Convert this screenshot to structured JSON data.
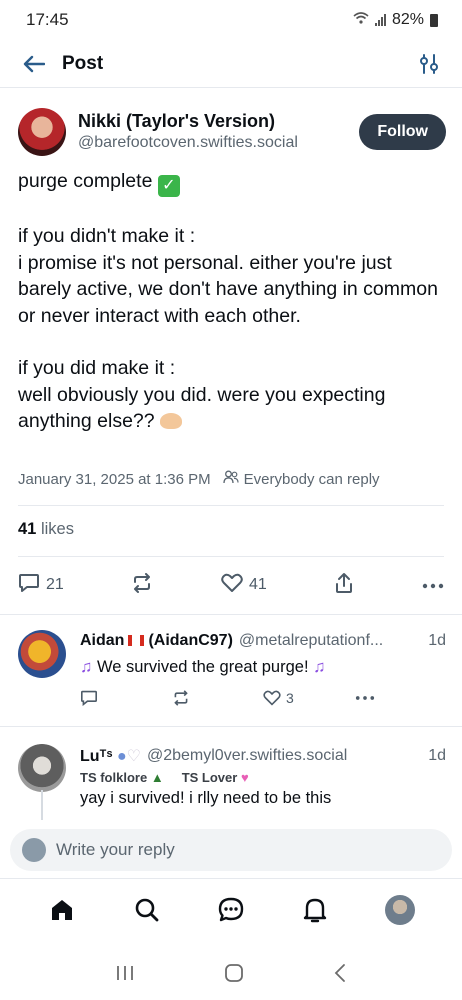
{
  "status_bar": {
    "time": "17:45",
    "battery": "82%"
  },
  "header": {
    "title": "Post"
  },
  "post": {
    "author_name": "Nikki (Taylor's Version)",
    "author_handle": "@barefootcoven.swifties.social",
    "follow_label": "Follow",
    "paragraph1": "purge complete",
    "paragraph2": "if you didn't make it :\ni promise it's not personal. either you're just barely active, we don't have anything in common or never interact with each other.",
    "paragraph3": "if you did make it :\nwell obviously you did. were you expecting anything else??",
    "timestamp": "January 31, 2025 at 1:36 PM",
    "reply_setting": "Everybody can reply",
    "likes_count": "41",
    "likes_label": "likes",
    "reply_count": "21",
    "like_count_action": "41"
  },
  "replies": [
    {
      "name": "Aidan",
      "name_suffix": "(AidanC97)",
      "handle": "@metalreputationf...",
      "time": "1d",
      "text": "We survived the great purge!",
      "like_count": "3"
    },
    {
      "name": "Luᵀˢ",
      "handle": "@2bemyl0ver.swifties.social",
      "time": "1d",
      "badge1": "TS folklore",
      "badge2": "TS Lover",
      "text": "yay i survived! i rlly need to be this"
    }
  ],
  "composer": {
    "placeholder": "Write your reply"
  },
  "colors": {
    "follow_bg": "#2f3b49",
    "muted": "#5b6670",
    "note_purple": "#8a4ee0",
    "check_green": "#3bb54a"
  }
}
